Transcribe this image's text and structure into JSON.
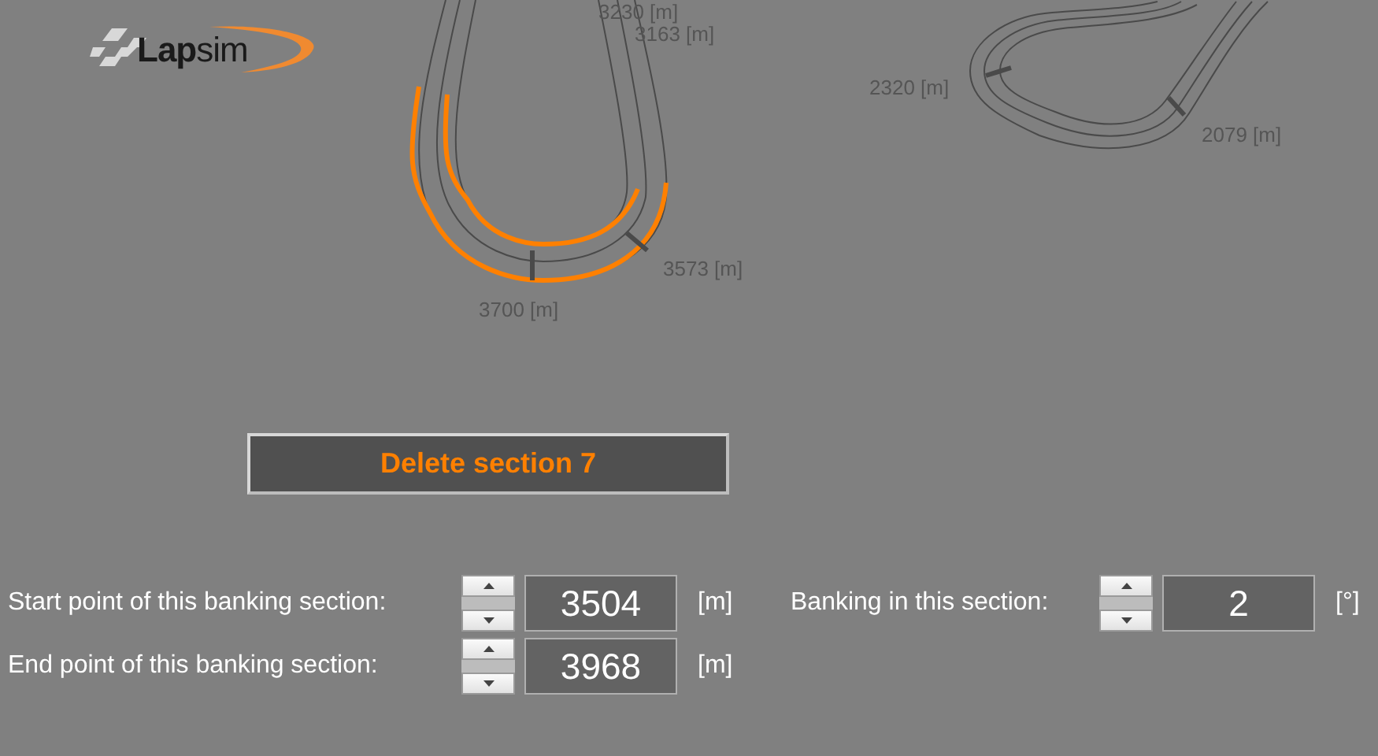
{
  "logo": {
    "text": "**Lap**sim"
  },
  "track_map": {
    "markers": [
      {
        "label": "3230 [m]"
      },
      {
        "label": "3163 [m]"
      },
      {
        "label": "3573 [m]"
      },
      {
        "label": "3700 [m]"
      },
      {
        "label": "2320 [m]"
      },
      {
        "label": "2079 [m]"
      }
    ]
  },
  "delete_button": {
    "label": "Delete section 7"
  },
  "fields": [
    {
      "label": "Start point of this banking section:",
      "value": "3504",
      "unit": "[m]"
    },
    {
      "label": "End point of this banking section:",
      "value": "3968",
      "unit": "[m]"
    }
  ],
  "banking": {
    "label": "Banking in this section:",
    "value": "2",
    "unit": "[°]"
  }
}
